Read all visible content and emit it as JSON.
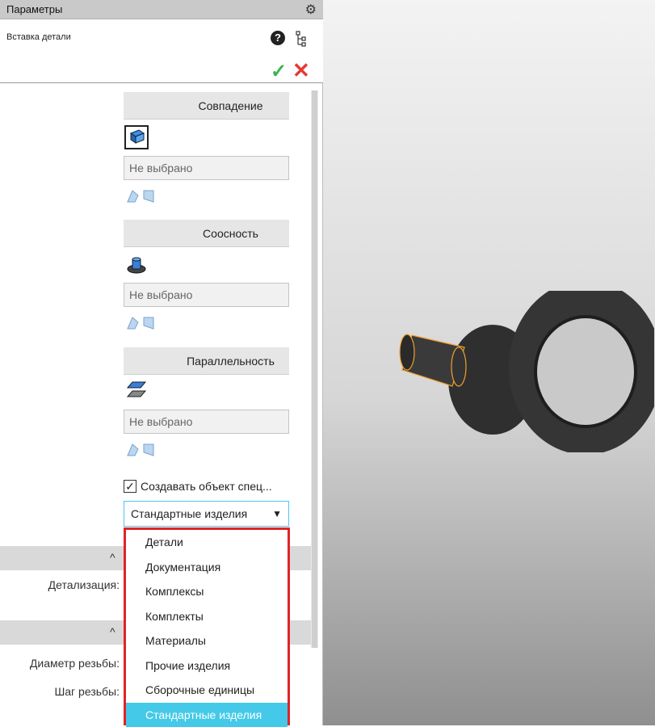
{
  "panel": {
    "title": "Параметры",
    "operation": "Вставка детали",
    "icons": [
      "gear-icon",
      "help-icon",
      "tree-icon",
      "ok-icon",
      "cancel-icon"
    ]
  },
  "constraints": [
    {
      "label": "Совпадение",
      "field_value": "Не выбрано"
    },
    {
      "label": "Соосность",
      "field_value": "Не выбрано"
    },
    {
      "label": "Параллельность",
      "field_value": "Не выбрано"
    }
  ],
  "spec": {
    "checkbox_label": "Создавать объект спец...",
    "checked": true,
    "section_selected": "Стандартные изделия",
    "options": [
      "Детали",
      "Документация",
      "Комплексы",
      "Комплекты",
      "Материалы",
      "Прочие изделия",
      "Сборочные единицы",
      "Стандартные изделия"
    ]
  },
  "properties": {
    "detail_label": "Детализация:",
    "thread_diameter_label": "Диаметр резьбы:",
    "thread_pitch_label": "Шаг резьбы:"
  },
  "colors": {
    "highlight": "#44c9e8",
    "dropdown_border": "#e0232a",
    "ok": "#3bb24a",
    "cancel": "#e53935"
  }
}
